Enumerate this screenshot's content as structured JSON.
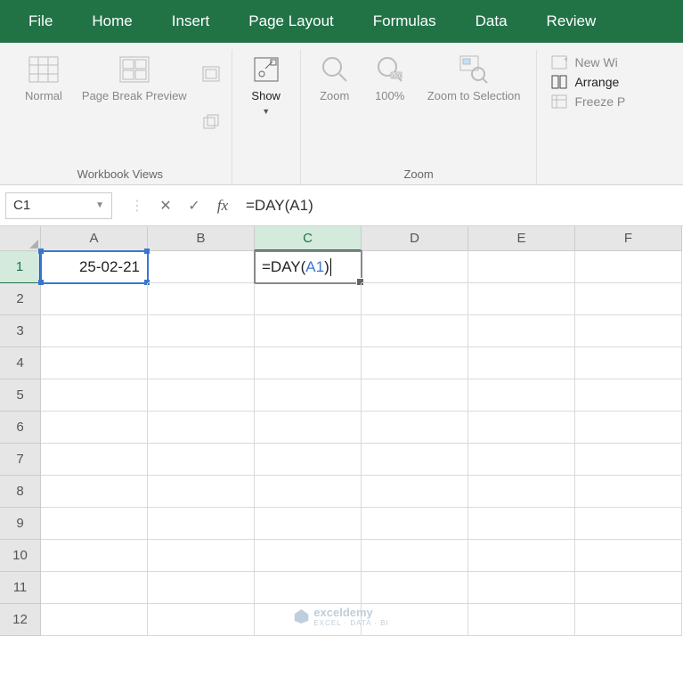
{
  "tabs": {
    "file": "File",
    "home": "Home",
    "insert": "Insert",
    "page": "Page Layout",
    "formulas": "Formulas",
    "data": "Data",
    "review": "Review"
  },
  "ribbon": {
    "wb_views": {
      "normal": "Normal",
      "page_break": "Page Break Preview",
      "label": "Workbook Views",
      "show": "Show"
    },
    "zoom": {
      "zoom": "Zoom",
      "p100": "100%",
      "sel": "Zoom to Selection",
      "label": "Zoom"
    },
    "win": {
      "new": "New Wi",
      "arrange": "Arrange",
      "freeze": "Freeze P"
    }
  },
  "namebox": "C1",
  "formula": "=DAY(A1)",
  "columns": [
    "A",
    "B",
    "C",
    "D",
    "E",
    "F"
  ],
  "rows": [
    "1",
    "2",
    "3",
    "4",
    "5",
    "6",
    "7",
    "8",
    "9",
    "10",
    "11",
    "12"
  ],
  "cells": {
    "A1": "25-02-21",
    "C1_prefix": "=DAY(",
    "C1_ref": "A1",
    "C1_suffix": ")"
  },
  "watermark": {
    "brand": "exceldemy",
    "tag": "EXCEL · DATA · BI"
  }
}
